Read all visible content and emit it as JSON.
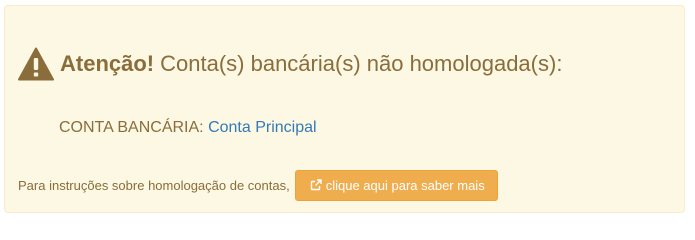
{
  "alert": {
    "heading_strong": "Atenção!",
    "heading_text": "Conta(s) bancária(s) não homologada(s):",
    "icon": "warning-triangle-icon",
    "colors": {
      "background": "#fcf8e3",
      "border": "#faebcc",
      "text": "#8a6d3b"
    }
  },
  "account": {
    "label": "CONTA BANCÁRIA:",
    "link_text": "Conta Principal",
    "link_color": "#337ab7"
  },
  "instructions": {
    "text": "Para instruções sobre homologação de contas,",
    "button_label": "clique aqui para saber mais",
    "button_icon": "external-link-icon",
    "button_color": "#f0ad4e"
  }
}
